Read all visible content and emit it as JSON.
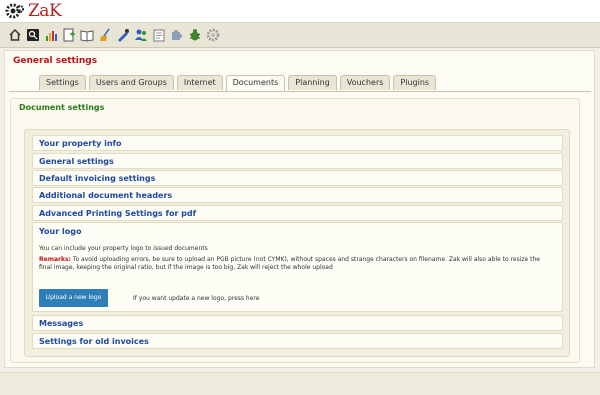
{
  "app": {
    "logo_text": "ZaK"
  },
  "toolbar": {
    "icons": [
      "home-icon",
      "search-icon",
      "bar-chart-icon",
      "add-document-icon",
      "book-icon",
      "broom-icon",
      "user-edit-icon",
      "users-icon",
      "note-icon",
      "puzzle-icon",
      "bug-icon",
      "gear-icon"
    ]
  },
  "page": {
    "title": "General settings",
    "tabs": [
      "Settings",
      "Users and Groups",
      "Internet",
      "Documents",
      "Planning",
      "Vouchers",
      "Plugins"
    ],
    "active_tab": "Documents"
  },
  "documents": {
    "title": "Document settings",
    "sections": {
      "property_info": "Your property info",
      "general": "General settings",
      "invoicing": "Default invoicing settings",
      "headers": "Additional document headers",
      "advanced_pdf": "Advanced Printing Settings for pdf",
      "logo": "Your logo",
      "messages": "Messages",
      "old_invoices": "Settings for old invoices"
    },
    "logo": {
      "description": "You can include your property logo to issued documents",
      "remarks_label": "Remarks:",
      "remarks_text": " To avoid uploading errors, be sure to upload an PGB picture (not CYMK), without spaces and strange characters on filename. Zak will also able to resize the final image, keeping the original ratio, but if the image is too big, Zak will reject the whole upload",
      "upload_button": "Upload a new logo",
      "upload_hint": "If you want update a new logo, press here"
    }
  },
  "colors": {
    "brand_red": "#c0141a",
    "section_green": "#2a7a1a",
    "link_blue": "#1f4aa0",
    "button_blue": "#2e7fb8"
  }
}
